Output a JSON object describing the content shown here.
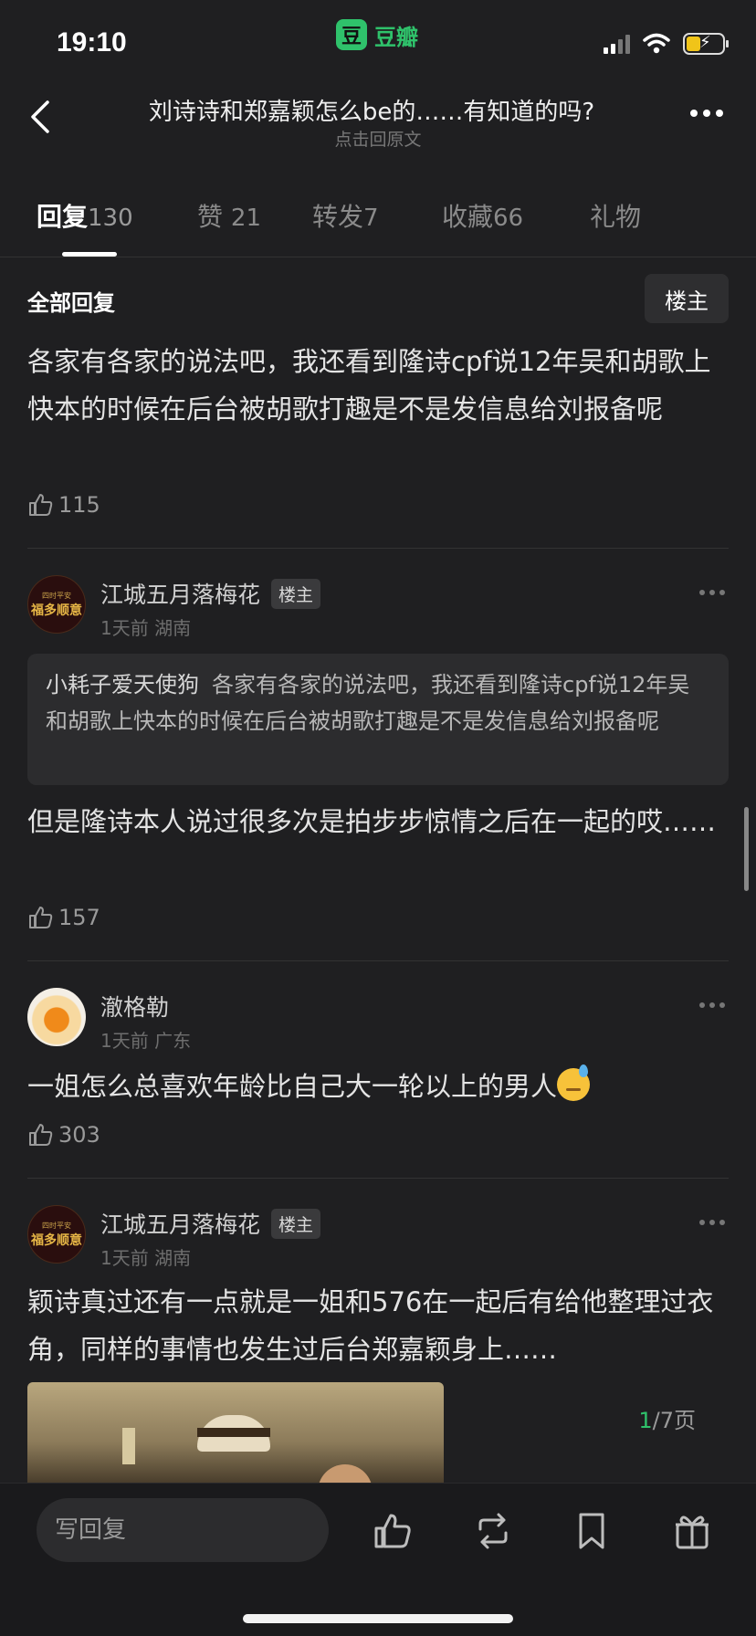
{
  "status": {
    "time": "19:10",
    "app_icon_glyph": "豆",
    "app_name": "豆瓣",
    "battery_bolt": "⚡"
  },
  "nav": {
    "title": "刘诗诗和郑嘉颖怎么be的……有知道的吗?",
    "subtitle": "点击回原文"
  },
  "tabs": [
    {
      "label": "回复",
      "count": "130"
    },
    {
      "label": "赞",
      "count": "21"
    },
    {
      "label": "转发",
      "count": "7"
    },
    {
      "label": "收藏",
      "count": "66"
    },
    {
      "label": "礼物",
      "count": ""
    }
  ],
  "section": {
    "title": "全部回复",
    "op_filter": "楼主"
  },
  "first_reply": {
    "text": "各家有各家的说法吧，我还看到隆诗cpf说12年吴和胡歌上快本的时候在后台被胡歌打趣是不是发信息给刘报备呢",
    "likes": "115"
  },
  "replies": [
    {
      "username": "江城五月落梅花",
      "tag": "楼主",
      "avatar_top": "四时平安",
      "avatar_main": "福多顺意",
      "meta": "1天前 湖南",
      "quote_user": "小耗子爱天使狗",
      "quote_text": "各家有各家的说法吧，我还看到隆诗cpf说12年吴和胡歌上快本的时候在后台被胡歌打趣是不是发信息给刘报备呢",
      "text": "但是隆诗本人说过很多次是拍步步惊情之后在一起的哎……",
      "likes": "157"
    },
    {
      "username": "澈格勒",
      "meta": "1天前 广东",
      "text": "一姐怎么总喜欢年龄比自己大一轮以上的男人",
      "likes": "303"
    },
    {
      "username": "江城五月落梅花",
      "tag": "楼主",
      "avatar_top": "四时平安",
      "avatar_main": "福多顺意",
      "meta": "1天前 湖南",
      "text": "颖诗真过还有一点就是一姐和576在一起后有给他整理过衣角，同样的事情也发生过后台郑嘉颖身上……"
    }
  ],
  "pager": {
    "current": "1",
    "total": "/7页"
  },
  "bottom": {
    "reply_placeholder": "写回复"
  },
  "colors": {
    "accent": "#2fc26b",
    "background": "#1f1f21"
  }
}
